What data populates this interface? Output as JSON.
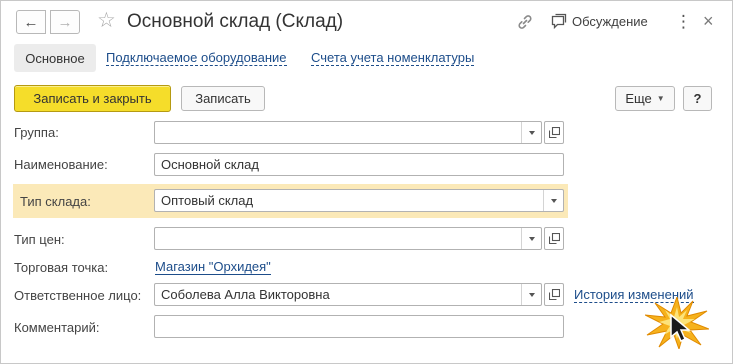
{
  "header": {
    "title": "Основной склад (Склад)",
    "discussion_label": "Обсуждение",
    "icons": {
      "back": "arrow-left-icon",
      "forward": "arrow-right-icon",
      "favorite": "star-icon",
      "link": "link-icon",
      "discussion": "chat-bubble-icon",
      "more": "more-vertical-icon",
      "close": "close-icon"
    },
    "glyphs": {
      "back": "←",
      "forward": "→",
      "star": "☆",
      "more": "⋮",
      "close": "×"
    }
  },
  "tabs": [
    {
      "label": "Основное",
      "active": true
    },
    {
      "label": "Подключаемое оборудование",
      "active": false
    },
    {
      "label": "Счета учета номенклатуры",
      "active": false
    }
  ],
  "toolbar": {
    "save_close_label": "Записать и закрыть",
    "save_label": "Записать",
    "more_label": "Еще",
    "help_label": "?"
  },
  "form": {
    "group": {
      "label": "Группа:",
      "value": ""
    },
    "name": {
      "label": "Наименование:",
      "value": "Основной склад"
    },
    "warehouse_type": {
      "label": "Тип склада:",
      "value": "Оптовый склад"
    },
    "price_type": {
      "label": "Тип цен:",
      "value": ""
    },
    "retail_point": {
      "label": "Торговая точка:",
      "value": "Магазин \"Орхидея\""
    },
    "responsible": {
      "label": "Ответственное лицо:",
      "value": "Соболева Алла Викторовна",
      "history_link": "История изменений"
    },
    "comment": {
      "label": "Комментарий:",
      "value": ""
    }
  },
  "colors": {
    "primary_button": "#f5dd2a",
    "row_highlight": "#fbe9b8",
    "link": "#1d4d8a",
    "cursor_burst": "#f6b21c"
  }
}
